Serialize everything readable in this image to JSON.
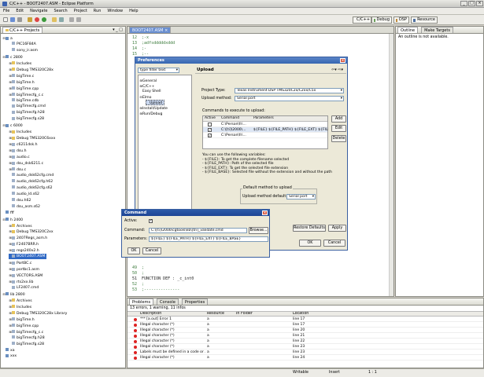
{
  "window": {
    "title": "C/C++ - BOOT2407.ASM - Eclipse Platform"
  },
  "menu": [
    "File",
    "Edit",
    "Navigate",
    "Search",
    "Project",
    "Run",
    "Window",
    "Help"
  ],
  "perspectives": [
    {
      "label": "C/C++",
      "color": "#4a7ed0"
    },
    {
      "label": "Debug",
      "color": "#6aa05a"
    },
    {
      "label": "DSP",
      "color": "#c08a3a"
    },
    {
      "label": "Resource",
      "color": "#5070a0"
    }
  ],
  "projects": {
    "tab_label": "C/C++ Projects",
    "items": [
      {
        "depth": 0,
        "tw": "-",
        "label": "a",
        "kind": "project"
      },
      {
        "depth": 1,
        "tw": "",
        "label": "PIC16F84A",
        "kind": "file"
      },
      {
        "depth": 1,
        "tw": "",
        "label": "sony_ir.asm",
        "kind": "file"
      },
      {
        "depth": 0,
        "tw": "-",
        "label": "c 2800",
        "kind": "project"
      },
      {
        "depth": 1,
        "tw": "+",
        "label": "Includes",
        "kind": "folder"
      },
      {
        "depth": 1,
        "tw": "+",
        "label": "Debug TMS320C28x",
        "kind": "folder"
      },
      {
        "depth": 1,
        "tw": "+",
        "label": "bigTime.c",
        "kind": "file"
      },
      {
        "depth": 1,
        "tw": "+",
        "label": "bigTime.h",
        "kind": "file"
      },
      {
        "depth": 1,
        "tw": "+",
        "label": "bigTime.cpp",
        "kind": "file"
      },
      {
        "depth": 1,
        "tw": "+",
        "label": "bigTimecfg_c.c",
        "kind": "file"
      },
      {
        "depth": 1,
        "tw": "",
        "label": "bigTime.cdb",
        "kind": "file"
      },
      {
        "depth": 1,
        "tw": "",
        "label": "bigTimecfg.cmd",
        "kind": "file"
      },
      {
        "depth": 1,
        "tw": "",
        "label": "bigTimecfg.h28",
        "kind": "file"
      },
      {
        "depth": 1,
        "tw": "",
        "label": "bigTimecfg.s28",
        "kind": "file"
      },
      {
        "depth": 0,
        "tw": "-",
        "label": "c 6000",
        "kind": "project"
      },
      {
        "depth": 1,
        "tw": "+",
        "label": "Includes",
        "kind": "folder"
      },
      {
        "depth": 1,
        "tw": "+",
        "label": "Debug TMS320C6xxx",
        "kind": "folder"
      },
      {
        "depth": 1,
        "tw": "+",
        "label": "c6211dsk.h",
        "kind": "file"
      },
      {
        "depth": 1,
        "tw": "+",
        "label": "dsu.h",
        "kind": "file"
      },
      {
        "depth": 1,
        "tw": "+",
        "label": "audio.c",
        "kind": "file"
      },
      {
        "depth": 1,
        "tw": "+",
        "label": "dsu_dsk6211.c",
        "kind": "file"
      },
      {
        "depth": 1,
        "tw": "+",
        "label": "dsu.c",
        "kind": "file"
      },
      {
        "depth": 1,
        "tw": "",
        "label": "audio_dsk62cfg.cmd",
        "kind": "file"
      },
      {
        "depth": 1,
        "tw": "",
        "label": "audio_dsk62cfg.h62",
        "kind": "file"
      },
      {
        "depth": 1,
        "tw": "",
        "label": "audio_dsk62cfg.s62",
        "kind": "file"
      },
      {
        "depth": 1,
        "tw": "",
        "label": "audio_ld.s62",
        "kind": "file"
      },
      {
        "depth": 1,
        "tw": "",
        "label": "dsu.h62",
        "kind": "file"
      },
      {
        "depth": 1,
        "tw": "",
        "label": "dsu_asm.s62",
        "kind": "file"
      },
      {
        "depth": 0,
        "tw": "",
        "label": "fff",
        "kind": "project"
      },
      {
        "depth": 0,
        "tw": "-",
        "label": "h 2400",
        "kind": "project"
      },
      {
        "depth": 1,
        "tw": "+",
        "label": "Archives",
        "kind": "folder"
      },
      {
        "depth": 1,
        "tw": "+",
        "label": "Debug TMS320C2xx",
        "kind": "folder"
      },
      {
        "depth": 1,
        "tw": "+",
        "label": "2407Regs_asm.h",
        "kind": "file"
      },
      {
        "depth": 1,
        "tw": "+",
        "label": "F2407BRR.h",
        "kind": "file"
      },
      {
        "depth": 1,
        "tw": "+",
        "label": "regs240x2.h",
        "kind": "file"
      },
      {
        "depth": 1,
        "tw": "",
        "label": "BOOT2407.ASM",
        "kind": "file",
        "selected": true
      },
      {
        "depth": 1,
        "tw": "+",
        "label": "PortBC.c",
        "kind": "file"
      },
      {
        "depth": 1,
        "tw": "+",
        "label": "portbc1.asm",
        "kind": "file"
      },
      {
        "depth": 1,
        "tw": "+",
        "label": "VECTORS.ASM",
        "kind": "file"
      },
      {
        "depth": 1,
        "tw": "+",
        "label": "rts2xx.lib",
        "kind": "file"
      },
      {
        "depth": 1,
        "tw": "",
        "label": "LF2407.cmd",
        "kind": "file"
      },
      {
        "depth": 0,
        "tw": "-",
        "label": "lib 2800",
        "kind": "project"
      },
      {
        "depth": 1,
        "tw": "+",
        "label": "Archives",
        "kind": "folder"
      },
      {
        "depth": 1,
        "tw": "+",
        "label": "Includes",
        "kind": "folder"
      },
      {
        "depth": 1,
        "tw": "+",
        "label": "Debug TMS320C28x Library",
        "kind": "folder"
      },
      {
        "depth": 1,
        "tw": "+",
        "label": "bigTime.h",
        "kind": "file"
      },
      {
        "depth": 1,
        "tw": "+",
        "label": "bigTime.cpp",
        "kind": "file"
      },
      {
        "depth": 1,
        "tw": "+",
        "label": "bigTimecfg_c.c",
        "kind": "file"
      },
      {
        "depth": 1,
        "tw": "",
        "label": "bigTimecfg.h28",
        "kind": "file"
      },
      {
        "depth": 1,
        "tw": "",
        "label": "bigTimecfg.s28",
        "kind": "file"
      },
      {
        "depth": 0,
        "tw": "",
        "label": "xa",
        "kind": "project"
      },
      {
        "depth": 0,
        "tw": "",
        "label": "xxx",
        "kind": "project"
      }
    ]
  },
  "editor": {
    "tab_label": "BOOT2407.ASM",
    "top_lines": [
      "12  ;-x",
      "13  ;adfsdddddxddd",
      "14  ;-",
      "15  ;--"
    ],
    "bottom_lines": [
      "49  ;",
      "50  ;",
      "51  FUNCTION DEF : _c_int0",
      "52  ;",
      "53  ;---------------"
    ]
  },
  "outline": {
    "tabs": [
      "Outline",
      "Make Targets"
    ],
    "message": "An outline is not available."
  },
  "preferences": {
    "title": "Preferences",
    "filter_placeholder": "type filter text",
    "tree": [
      {
        "label": "General",
        "depth": 0,
        "tw": "+"
      },
      {
        "label": "C/C++",
        "depth": 0,
        "tw": "+"
      },
      {
        "label": "Easy Shell",
        "depth": 0,
        "tw": ""
      },
      {
        "label": "Elmo",
        "depth": 0,
        "tw": "-"
      },
      {
        "label": "Upload",
        "depth": 1,
        "tw": "",
        "selected": true
      },
      {
        "label": "Install/Update",
        "depth": 0,
        "tw": "+"
      },
      {
        "label": "Run/Debug",
        "depth": 0,
        "tw": "+"
      }
    ],
    "page_title": "Upload",
    "project_type_label": "Project Type:",
    "project_type_value": "Texas Instrument DSP TMS320C2x/C2xx/C5x",
    "upload_method_label": "Upload method:",
    "upload_method_value": "Serial port",
    "commands_label": "Commands to execute to upload:",
    "columns": [
      "Active",
      "Command",
      "Parameters"
    ],
    "rows": [
      {
        "active": false,
        "command": "C:\\Person\\fri...",
        "params": ""
      },
      {
        "active": true,
        "command": "C:\\[ti]\\2000\\...",
        "params": "${FILE} ${FILE_PATH} ${FILE_EXT} ${FILE..."
      },
      {
        "active": true,
        "command": "C:\\Person\\fri...",
        "params": ""
      }
    ],
    "buttons": {
      "add": "Add",
      "edit": "Edit",
      "delete": "Delete",
      "restore": "Restore Defaults",
      "apply": "Apply",
      "ok": "OK",
      "cancel": "Cancel"
    },
    "help_lines": [
      "You can use the following variables:",
      "- ${FILE}: To get the complete filename selected",
      "- ${FILE_PATH}: Path of the selected file",
      "- ${FILE_EXT}: To get the selected file extension",
      "- ${FILE_BASE}: Selected file without the extension and without the path"
    ],
    "default_group_label": "Default method to upload",
    "default_method_label": "Upload method default:",
    "default_method_value": "Serial port"
  },
  "command_dialog": {
    "title": "Command",
    "active_label": "Active:",
    "command_label": "Command:",
    "command_value": "C:\\[ti]\\2000\\cgtools\\lib\\[tri]_validate.cmd",
    "browse": "Browse...",
    "parameters_label": "Parameters:",
    "parameters_value": "${FILE} ${FILE_PATH} ${FILE_EXT} ${FILE_BASE}",
    "ok": "OK",
    "cancel": "Cancel"
  },
  "problems": {
    "tabs": [
      "Problems",
      "Console",
      "Properties"
    ],
    "summary": "13 errors, 1 warning, 11 infos",
    "columns": [
      "Description",
      "Resource",
      "In Folder",
      "Location"
    ],
    "rows": [
      {
        "desc": "*** [a.out] Error 1",
        "res": "a",
        "loc": "line 17"
      },
      {
        "desc": "Illegal character (*)",
        "res": "a",
        "loc": "line 17"
      },
      {
        "desc": "Illegal character (*)",
        "res": "a",
        "loc": "line 20"
      },
      {
        "desc": "Illegal character (*)",
        "res": "a",
        "loc": "line 21"
      },
      {
        "desc": "Illegal character (*)",
        "res": "a",
        "loc": "line 22"
      },
      {
        "desc": "Illegal character (*)",
        "res": "a",
        "loc": "line 23"
      },
      {
        "desc": "Labels must be defined in a code or ...",
        "res": "a",
        "loc": "line 23"
      },
      {
        "desc": "Illegal character (*)",
        "res": "a",
        "loc": "line 24"
      }
    ]
  },
  "status": {
    "writable": "Writable",
    "insert": "Insert",
    "position": "1 : 1"
  }
}
